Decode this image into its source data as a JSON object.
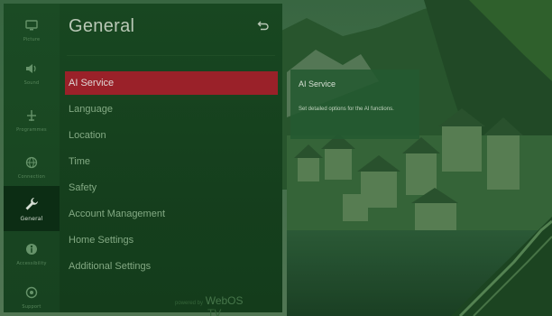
{
  "rail": {
    "items": [
      {
        "label": "Picture",
        "icon": "picture-icon"
      },
      {
        "label": "Sound",
        "icon": "speaker-icon"
      },
      {
        "label": "Programmes",
        "icon": "antenna-icon"
      },
      {
        "label": "Connection",
        "icon": "globe-icon"
      },
      {
        "label": "General",
        "icon": "wrench-icon",
        "active": true
      },
      {
        "label": "Accessibility",
        "icon": "accessibility-icon"
      },
      {
        "label": "Support",
        "icon": "support-icon"
      }
    ]
  },
  "panel": {
    "title": "General",
    "back_icon": "back-arrow-icon",
    "menu": [
      {
        "label": "AI Service",
        "active": true
      },
      {
        "label": "Language"
      },
      {
        "label": "Location"
      },
      {
        "label": "Time"
      },
      {
        "label": "Safety"
      },
      {
        "label": "Account Management"
      },
      {
        "label": "Home Settings"
      },
      {
        "label": "Additional Settings"
      }
    ],
    "footer": {
      "prefix": "powered by",
      "brand": "WebOS",
      "suffix": "TV"
    }
  },
  "info": {
    "title": "AI Service",
    "description": "Set detailed options for the AI functions."
  },
  "colors": {
    "accent": "#a8212c",
    "panel": "#1b4a23",
    "rail": "#1e4f26",
    "active_rail": "#0e2e15"
  }
}
